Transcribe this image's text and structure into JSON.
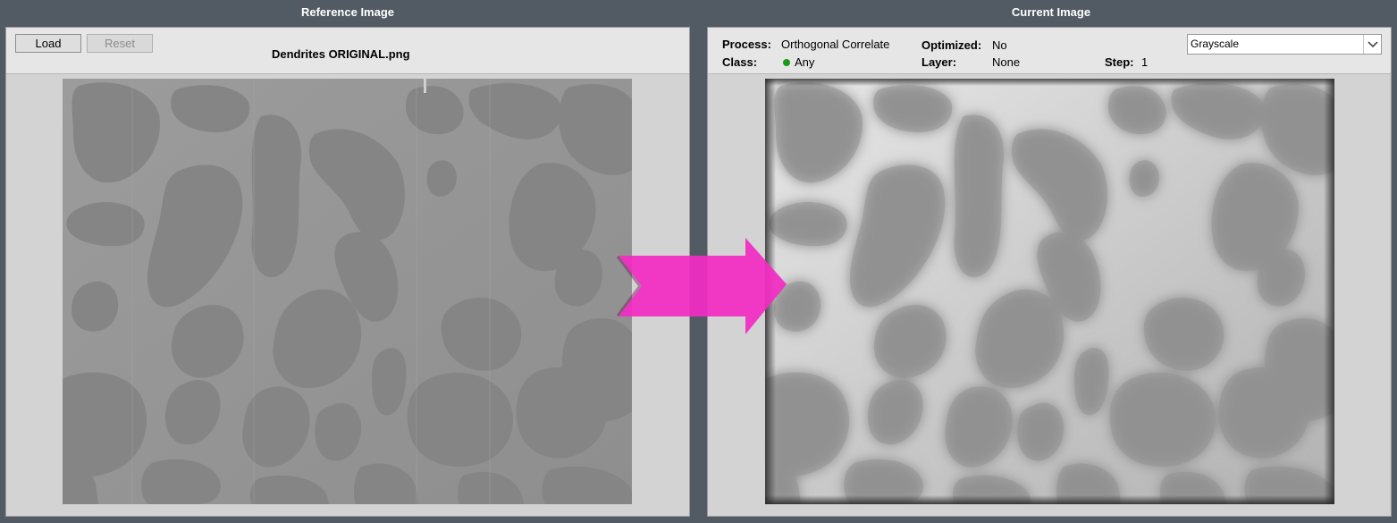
{
  "reference": {
    "title": "Reference Image",
    "load_label": "Load",
    "reset_label": "Reset",
    "file_name": "Dendrites ORIGINAL.png"
  },
  "current": {
    "title": "Current Image",
    "process_label": "Process:",
    "process_value": "Orthogonal Correlate",
    "optimized_label": "Optimized:",
    "optimized_value": "No",
    "class_label": "Class:",
    "class_value": "Any",
    "class_color": "#1a9a1a",
    "layer_label": "Layer:",
    "layer_value": "None",
    "step_label": "Step:",
    "step_value": "1",
    "mode_select": "Grayscale"
  },
  "colors": {
    "background": "#525a63",
    "overlay_arrow": "#f22cc4"
  },
  "icons": {
    "overlay": "right-arrow-icon",
    "dropdown": "chevron-down-icon"
  }
}
